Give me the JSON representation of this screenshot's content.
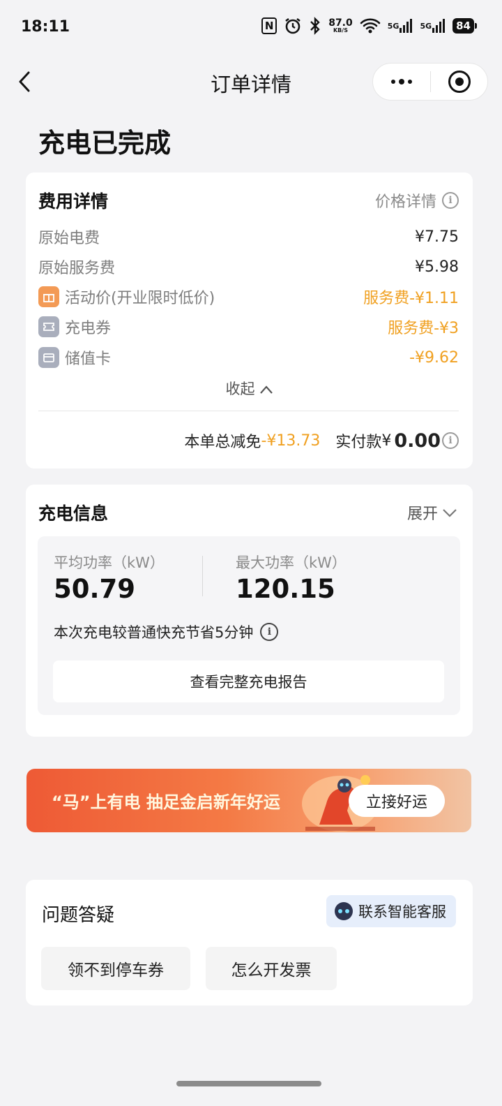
{
  "status_bar": {
    "time": "18:11",
    "net_speed_value": "87.0",
    "net_speed_unit": "KB/S",
    "signal_1": "5G",
    "signal_2": "5G",
    "battery": "84"
  },
  "nav": {
    "title": "订单详情"
  },
  "page_title": "充电已完成",
  "fee_card": {
    "title": "费用详情",
    "price_detail_link": "价格详情",
    "rows": [
      {
        "label": "原始电费",
        "value": "¥7.75"
      },
      {
        "label": "原始服务费",
        "value": "¥5.98"
      },
      {
        "label": "活动价(开业限时低价)",
        "value": "服务费-¥1.11",
        "icon": "gift-icon"
      },
      {
        "label": "充电券",
        "value": "服务费-¥3",
        "icon": "ticket-icon"
      },
      {
        "label": "储值卡",
        "value": "-¥9.62",
        "icon": "card-icon"
      }
    ],
    "collapse_label": "收起",
    "total_discount_label": "本单总减免",
    "total_discount_value": "-¥13.73",
    "paid_label": "实付款",
    "paid_currency": "¥",
    "paid_amount": "0.00"
  },
  "charge_card": {
    "title": "充电信息",
    "expand_label": "展开",
    "avg_power_label": "平均功率（kW）",
    "avg_power_value": "50.79",
    "max_power_label": "最大功率（kW）",
    "max_power_value": "120.15",
    "save_note": "本次充电较普通快充节省5分钟",
    "report_button": "查看完整充电报告"
  },
  "banner": {
    "text": "“马”上有电 抽足金启新年好运",
    "button": "立接好运"
  },
  "qa_card": {
    "title": "问题答疑",
    "cs_button": "联系智能客服",
    "chips": [
      "领不到停车券",
      "怎么开发票"
    ]
  },
  "colors": {
    "accent_orange": "#f0a020",
    "banner_start": "#ee5a35",
    "page_bg": "#f3f3f5"
  }
}
